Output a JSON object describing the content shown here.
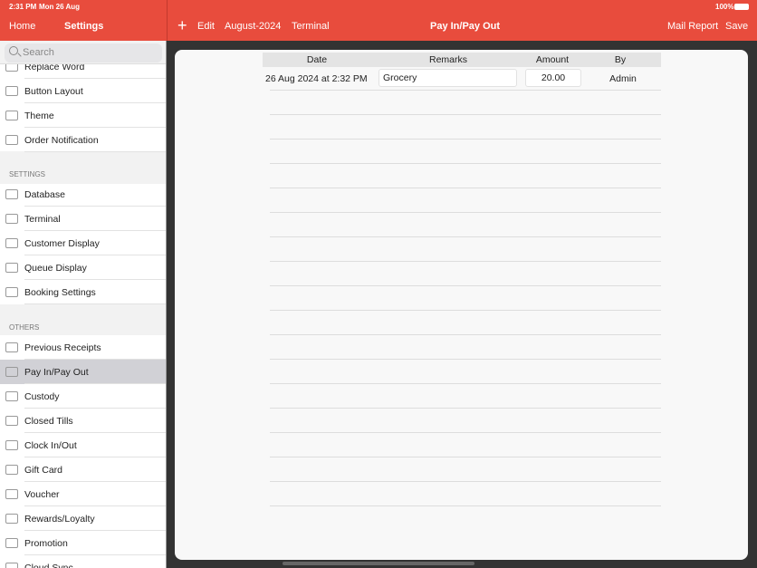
{
  "status": {
    "time": "2:31 PM",
    "date": "Mon 26 Aug",
    "battery": "100%"
  },
  "header": {
    "home": "Home",
    "settings": "Settings",
    "edit": "Edit",
    "month": "August-2024",
    "terminal": "Terminal",
    "title": "Pay In/Pay Out",
    "mail_report": "Mail Report",
    "save": "Save"
  },
  "sidebar": {
    "search_placeholder": "Search",
    "group1": [
      "Replace Word",
      "Button Layout",
      "Theme",
      "Order Notification"
    ],
    "settings_header": "SETTINGS",
    "group2": [
      "Database",
      "Terminal",
      "Customer Display",
      "Queue Display",
      "Booking Settings"
    ],
    "others_header": "OTHERS",
    "group3": [
      "Previous Receipts",
      "Pay In/Pay Out",
      "Custody",
      "Closed Tills",
      "Clock In/Out",
      "Gift Card",
      "Voucher",
      "Rewards/Loyalty",
      "Promotion",
      "Cloud Sync"
    ],
    "selected": "Pay In/Pay Out"
  },
  "table": {
    "columns": [
      "Date",
      "Remarks",
      "Amount",
      "By"
    ],
    "rows": [
      {
        "date": "26 Aug 2024 at 2:32 PM",
        "remarks": "Grocery",
        "amount": "20.00",
        "by": "Admin"
      }
    ]
  },
  "colors": {
    "accent": "#e84c3d",
    "selected": "#d1d1d6"
  }
}
